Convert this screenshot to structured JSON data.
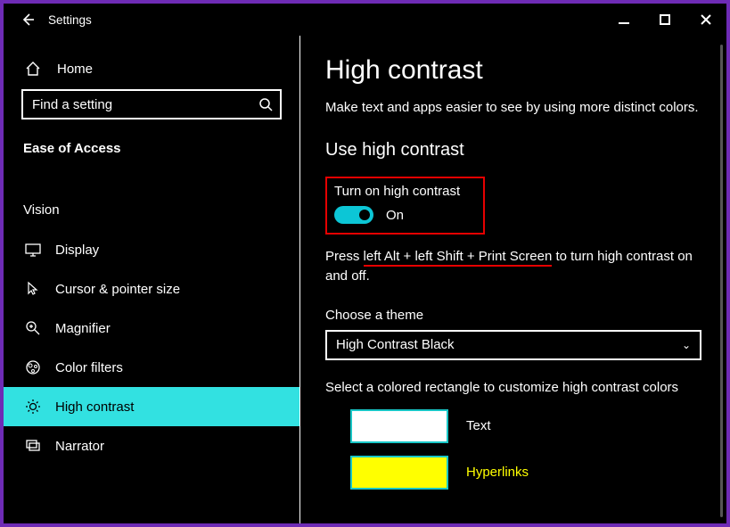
{
  "titlebar": {
    "title": "Settings"
  },
  "sidebar": {
    "home_label": "Home",
    "search_placeholder": "Find a setting",
    "section_header": "Ease of Access",
    "group_header": "Vision",
    "items": [
      {
        "label": "Display"
      },
      {
        "label": "Cursor & pointer size"
      },
      {
        "label": "Magnifier"
      },
      {
        "label": "Color filters"
      },
      {
        "label": "High contrast",
        "selected": true
      },
      {
        "label": "Narrator"
      }
    ]
  },
  "main": {
    "heading": "High contrast",
    "lead": "Make text and apps easier to see by using more distinct colors.",
    "section_heading": "Use high contrast",
    "toggle": {
      "label": "Turn on high contrast",
      "state": "On"
    },
    "hint_pre": "Press ",
    "hint_ul": "left Alt + left Shift + Print Screen",
    "hint_post": " to turn high contrast on and off.",
    "theme_label": "Choose a theme",
    "theme_value": "High Contrast Black",
    "customize_label": "Select a colored rectangle to customize high contrast colors",
    "swatches": [
      {
        "name": "Text",
        "color": "#ffffff"
      },
      {
        "name": "Hyperlinks",
        "color": "#ffff00"
      }
    ]
  }
}
